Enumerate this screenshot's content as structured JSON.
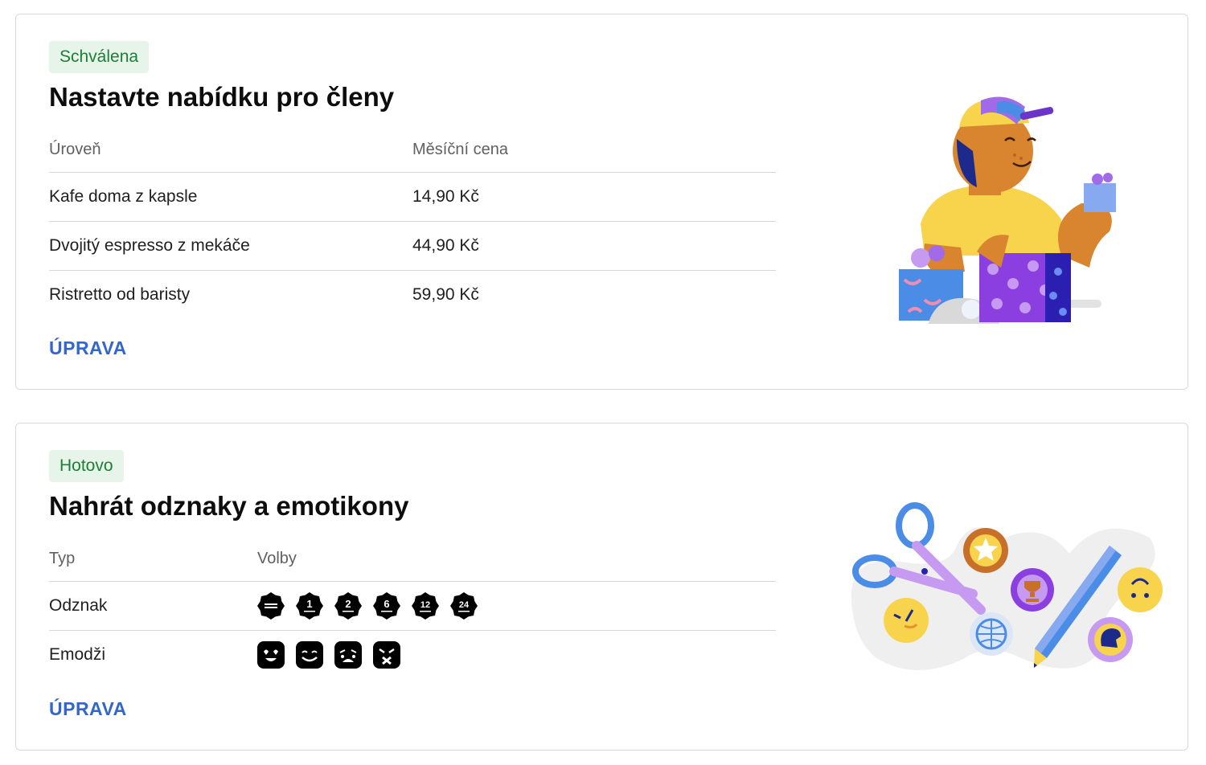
{
  "cards": [
    {
      "status": "Schválena",
      "title": "Nastavte nabídku pro členy",
      "headers": [
        "Úroveň",
        "Měsíční cena"
      ],
      "rows": [
        {
          "level": "Kafe doma z kapsle",
          "price": "14,90 Kč"
        },
        {
          "level": "Dvojitý espresso z mekáče",
          "price": "44,90 Kč"
        },
        {
          "level": "Ristretto od baristy",
          "price": "59,90 Kč"
        }
      ],
      "edit_label": "ÚPRAVA"
    },
    {
      "status": "Hotovo",
      "title": "Nahrát odznaky a emotikony",
      "headers": [
        "Typ",
        "Volby"
      ],
      "rows": [
        {
          "type": "Odznak",
          "options": [
            "badge-new-member-icon",
            "badge-1-month-icon",
            "badge-2-months-icon",
            "badge-6-months-icon",
            "badge-12-months-icon",
            "badge-24-months-icon"
          ],
          "badge_numbers": [
            "",
            "1",
            "2",
            "6",
            "12",
            "24"
          ]
        },
        {
          "type": "Emodži",
          "options": [
            "emoji-love-icon",
            "emoji-smile-icon",
            "emoji-cry-icon",
            "emoji-angry-icon"
          ]
        }
      ],
      "edit_label": "ÚPRAVA"
    }
  ],
  "colors": {
    "status_bg": "#e6f4ea",
    "status_text": "#1e7e34",
    "link": "#3366cc",
    "divider": "#d6d6d6"
  }
}
